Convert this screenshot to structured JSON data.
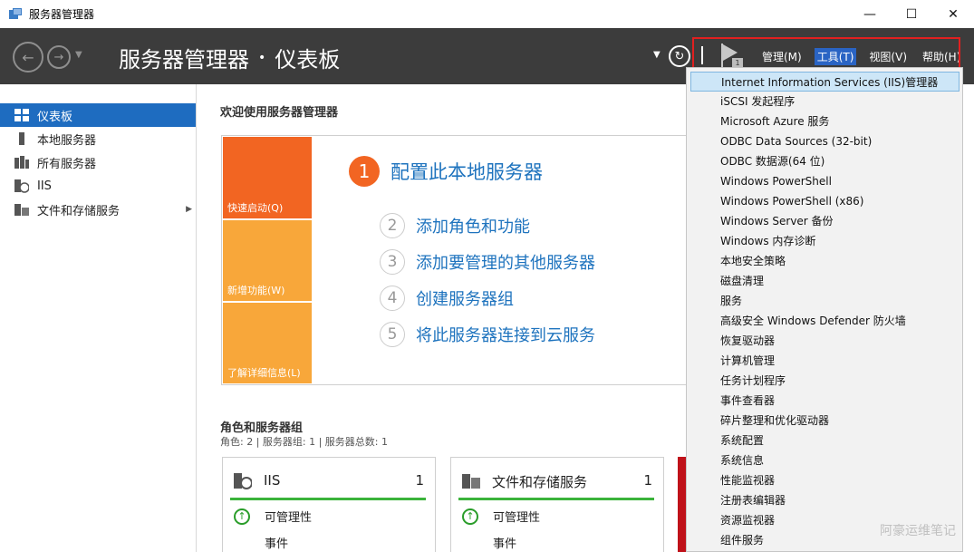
{
  "window": {
    "title": "服务器管理器",
    "controls": [
      "—",
      "☐",
      "✕"
    ]
  },
  "header": {
    "app_name": "服务器管理器",
    "separator": "•",
    "page": "仪表板",
    "notification_count": "1",
    "menus": [
      {
        "label": "管理(M)",
        "active": false
      },
      {
        "label": "工具(T)",
        "active": true
      },
      {
        "label": "视图(V)",
        "active": false
      },
      {
        "label": "帮助(H)",
        "active": false
      }
    ]
  },
  "sidebar": {
    "items": [
      {
        "label": "仪表板",
        "icon": "dashboard-icon",
        "selected": true
      },
      {
        "label": "本地服务器",
        "icon": "local-server-icon"
      },
      {
        "label": "所有服务器",
        "icon": "all-servers-icon"
      },
      {
        "label": "IIS",
        "icon": "iis-icon"
      },
      {
        "label": "文件和存储服务",
        "icon": "file-storage-icon",
        "has_submenu": true
      }
    ]
  },
  "main": {
    "welcome": "欢迎使用服务器管理器",
    "tiles": [
      "快速启动(Q)",
      "新增功能(W)",
      "了解详细信息(L)"
    ],
    "step1": {
      "num": "1",
      "label": "配置此本地服务器"
    },
    "steps": [
      {
        "num": "2",
        "label": "添加角色和功能"
      },
      {
        "num": "3",
        "label": "添加要管理的其他服务器"
      },
      {
        "num": "4",
        "label": "创建服务器组"
      },
      {
        "num": "5",
        "label": "将此服务器连接到云服务"
      }
    ],
    "roles_title": "角色和服务器组",
    "roles_sub": "角色: 2 | 服务器组: 1 | 服务器总数: 1",
    "cards": [
      {
        "name": "IIS",
        "count": "1",
        "manageability": "可管理性",
        "events": "事件"
      },
      {
        "name": "文件和存储服务",
        "count": "1",
        "manageability": "可管理性",
        "events": "事件"
      }
    ]
  },
  "tools_menu": {
    "items": [
      "Internet Information Services (IIS)管理器",
      "iSCSI 发起程序",
      "Microsoft Azure 服务",
      "ODBC Data Sources (32-bit)",
      "ODBC 数据源(64 位)",
      "Windows PowerShell",
      "Windows PowerShell (x86)",
      "Windows Server 备份",
      "Windows 内存诊断",
      "本地安全策略",
      "磁盘清理",
      "服务",
      "高级安全 Windows Defender 防火墙",
      "恢复驱动器",
      "计算机管理",
      "任务计划程序",
      "事件查看器",
      "碎片整理和优化驱动器",
      "系统配置",
      "系统信息",
      "性能监视器",
      "注册表编辑器",
      "资源监视器",
      "组件服务"
    ],
    "highlighted_index": 0
  },
  "watermark": "阿豪运维笔记",
  "colors": {
    "header_bg": "#3c3c3c",
    "selected_blue": "#1e6cc0",
    "tile_orange": "#f26522",
    "tile_amber": "#f8a73a",
    "link_blue": "#1e73be",
    "status_green": "#3bb33b",
    "annotation_red": "#e02020"
  }
}
